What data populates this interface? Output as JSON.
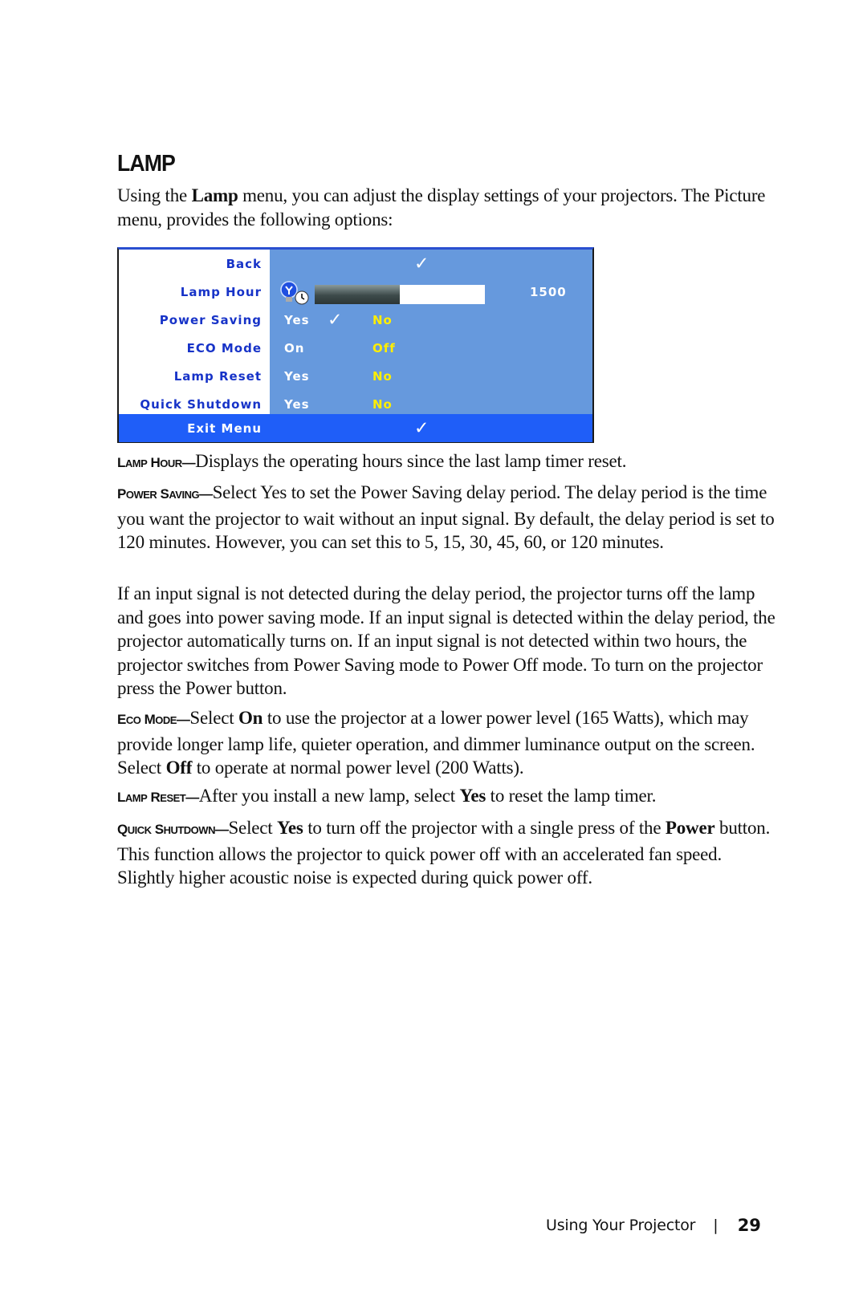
{
  "heading": "LAMP",
  "intro": {
    "part1": "Using the ",
    "bold": "Lamp",
    "part2": " menu, you can adjust the display settings of your projectors. The Picture menu, provides the following options:"
  },
  "osd_menu": {
    "items": [
      {
        "label": "Back"
      },
      {
        "label": "Lamp Hour",
        "value": "1500",
        "progress_fraction": 0.5
      },
      {
        "label": "Power Saving",
        "options": [
          "Yes",
          "No"
        ],
        "selected": "Yes"
      },
      {
        "label": "ECO Mode",
        "options": [
          "On",
          "Off"
        ],
        "selected": "Off"
      },
      {
        "label": "Lamp Reset",
        "options": [
          "Yes",
          "No"
        ],
        "selected": "No"
      },
      {
        "label": "Quick Shutdown",
        "options": [
          "Yes",
          "No"
        ],
        "selected": "No"
      },
      {
        "label": "Exit Menu"
      }
    ],
    "colors": {
      "panel": "#6699dd",
      "highlight": "#1f5ef8",
      "label_text": "#1733c8",
      "selected_text": "#ffee00"
    }
  },
  "sections": [
    {
      "term_a": "L",
      "term_a_sc": "AMP",
      "term_b": " H",
      "term_b_sc": "OUR",
      "dash": "—",
      "segments": [
        {
          "t": "Displays the operating hours since the last lamp timer reset."
        }
      ]
    },
    {
      "term_a": "P",
      "term_a_sc": "OWER",
      "term_b": " S",
      "term_b_sc": "AVING",
      "dash": "—",
      "segments": [
        {
          "t": "Select Yes to set the Power Saving delay period. The delay period is the time you want the projector to wait without an input signal. By default, the delay period is set to 120 minutes. However, you can set this to 5, 15, 30, 45, 60, or 120 minutes."
        }
      ]
    },
    {
      "plain": "If an input signal is not detected during the delay period, the projector turns off the lamp and goes into power saving mode. If an input signal is detected within the delay period, the projector automatically turns on. If an input signal is not detected within two hours, the projector switches from Power Saving mode to Power Off mode. To turn on the projector press the Power button."
    },
    {
      "term_a": "E",
      "term_a_sc": "CO",
      "term_b": " M",
      "term_b_sc": "ODE",
      "dash": "—",
      "segments": [
        {
          "t": "Select "
        },
        {
          "b": "On"
        },
        {
          "t": " to use the projector at a lower power level (165 Watts), which may provide longer lamp life, quieter operation, and dimmer luminance output on the screen. Select "
        },
        {
          "b": "Off"
        },
        {
          "t": " to operate at normal power level (200 Watts)."
        }
      ]
    },
    {
      "term_a": "L",
      "term_a_sc": "AMP",
      "term_b": " R",
      "term_b_sc": "ESET",
      "dash": "—",
      "segments": [
        {
          "t": "After you install a new lamp, select "
        },
        {
          "b": "Yes"
        },
        {
          "t": " to reset the lamp timer."
        }
      ]
    },
    {
      "term_a": "Q",
      "term_a_sc": "UICK",
      "term_b": " S",
      "term_b_sc": "HUTDOWN",
      "dash": "—",
      "segments": [
        {
          "t": "Select "
        },
        {
          "b": "Yes"
        },
        {
          "t": " to turn off the projector with a single press of the "
        },
        {
          "b": "Power"
        },
        {
          "t": " button. This function allows the projector to quick power off with an accelerated fan speed. Slightly higher acoustic noise is expected during quick power off."
        }
      ]
    }
  ],
  "footer": {
    "title": "Using Your Projector",
    "separator": "|",
    "page_number": "29"
  }
}
